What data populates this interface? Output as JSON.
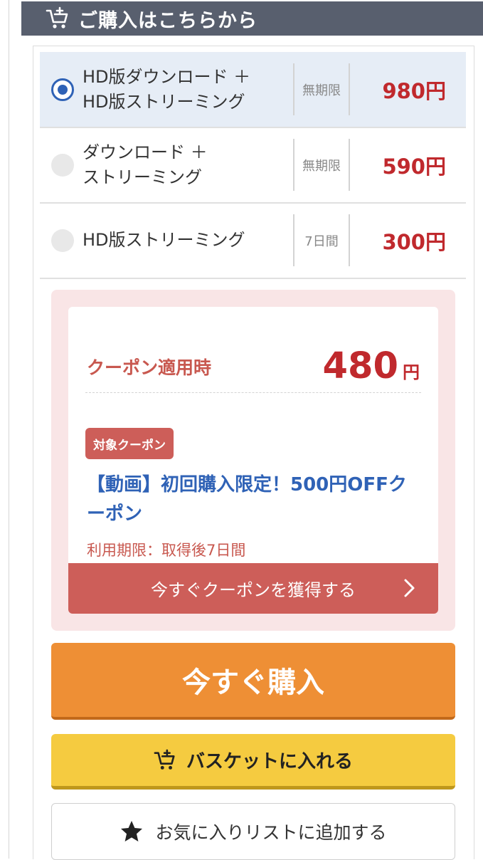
{
  "header": {
    "title": "ご購入はこちらから",
    "icon": "cart-plus-icon"
  },
  "options": [
    {
      "label": "HD版ダウンロード ＋\nHD版ストリーミング",
      "period": "無期限",
      "price": "980円",
      "selected": true
    },
    {
      "label": "ダウンロード ＋\nストリーミング",
      "period": "無期限",
      "price": "590円",
      "selected": false
    },
    {
      "label": "HD版ストリーミング",
      "period": "7日間",
      "price": "300円",
      "selected": false
    }
  ],
  "coupon": {
    "label": "クーポン適用時",
    "price": "480",
    "unit": "円",
    "badge": "対象クーポン",
    "name": "【動画】初回購入限定！500円OFFクーポン",
    "limit": "利用期限：取得後7日間",
    "button": "今すぐクーポンを獲得する"
  },
  "actions": {
    "buy": "今すぐ購入",
    "basket": "バスケットに入れる",
    "favorite": "お気に入りリストに追加する"
  },
  "colors": {
    "header_bg": "#585f6e",
    "price_red": "#c0292d",
    "link_blue": "#2f62b6",
    "coupon_red": "#cd5e59",
    "buy_orange": "#ee8f35",
    "basket_yellow": "#f5cb40"
  }
}
